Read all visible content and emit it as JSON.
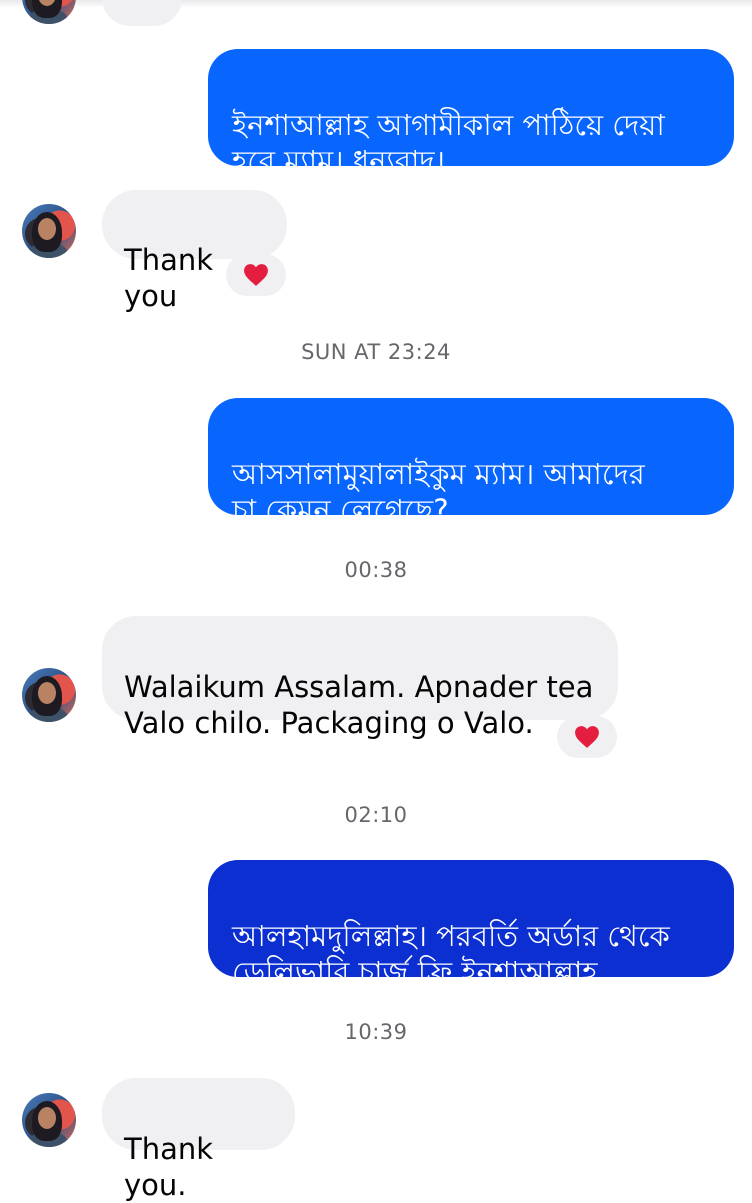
{
  "messages": {
    "m1_partial": {
      "text": ""
    },
    "m2": {
      "text": "ইনশাআল্লাহ আগামীকাল পাঠিয়ে দেয়া\nহবে ম্যাম। ধন্যবাদ।",
      "color": "#0866ff"
    },
    "m3": {
      "text": "Thank you",
      "reaction": "❤️"
    },
    "m4": {
      "text": "আসসালামুয়ালাইকুম ম্যাম। আমাদের\nচা কেমন লেগেছে?",
      "color": "#0866ff"
    },
    "m5": {
      "text": "Walaikum Assalam. Apnader tea\nValo chilo. Packaging o Valo.",
      "reaction": "❤️"
    },
    "m6": {
      "text": "আলহামদুলিল্লাহ। পরবর্তি অর্ডার থেকে\nডেলিভারি চার্জ ফ্রি ইনশাআল্লাহ",
      "color": "#0b2fd1"
    },
    "m7": {
      "text": "Thank you."
    }
  },
  "timestamps": {
    "t1": "SUN AT 23:24",
    "t2": "00:38",
    "t3": "02:10",
    "t4": "10:39"
  },
  "colors": {
    "outgoing_primary": "#0866ff",
    "outgoing_dark": "#0b2fd1",
    "incoming_bg": "#f0f0f2",
    "timestamp_text": "#65676b",
    "heart": "#e41e3f"
  },
  "icons": {
    "reaction": "heart-icon",
    "avatar": "contact-avatar"
  }
}
